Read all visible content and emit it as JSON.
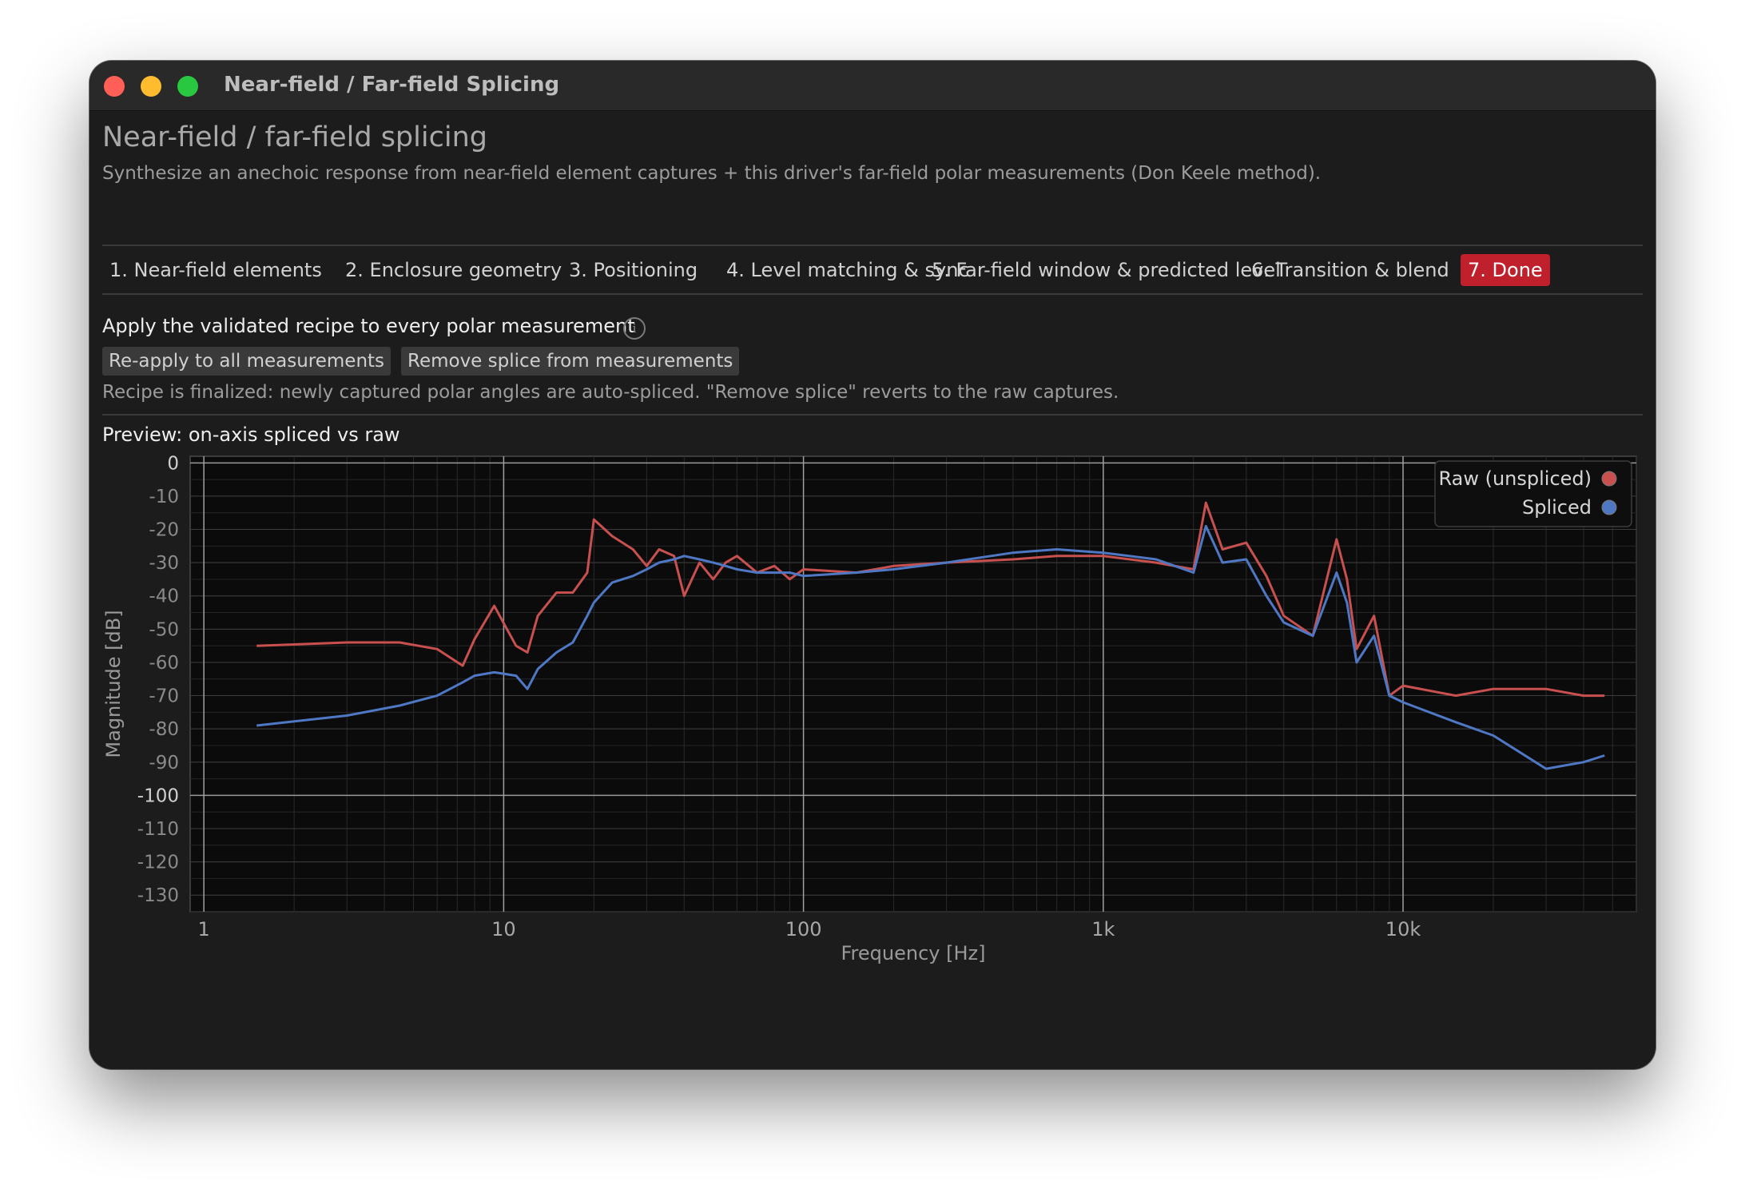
{
  "window": {
    "title": "Near-field / Far-field Splicing"
  },
  "header": {
    "title": "Near-field / far-field splicing",
    "subtitle": "Synthesize an anechoic response from near-field element captures + this driver's far-field polar measurements (Don Keele method)."
  },
  "tabs": [
    {
      "label": "1. Near-field elements"
    },
    {
      "label": "2. Enclosure geometry"
    },
    {
      "label": "3. Positioning"
    },
    {
      "label": "4. Level matching & sync"
    },
    {
      "label": "5. Far-field window & predicted level"
    },
    {
      "label": "6. Transition & blend"
    },
    {
      "label": "7. Done",
      "active": true
    }
  ],
  "apply": {
    "label": "Apply the validated recipe to every polar measurement",
    "info_icon": "i",
    "reapply_button": "Re-apply to all measurements",
    "remove_button": "Remove splice from measurements",
    "note": "Recipe is finalized: newly captured polar angles are auto-spliced. \"Remove splice\" reverts to the raw captures."
  },
  "preview": {
    "title": "Preview: on-axis spliced vs raw"
  },
  "colors": {
    "raw": "#c8504f",
    "spliced": "#4f78c4",
    "accent": "#c0202c"
  },
  "chart_data": {
    "type": "line",
    "xscale": "log",
    "xlabel": "Frequency [Hz]",
    "ylabel": "Magnitude [dB]",
    "xlim": [
      0.9,
      60000
    ],
    "ylim": [
      -135,
      2
    ],
    "xticks": [
      {
        "v": 1,
        "label": "1"
      },
      {
        "v": 10,
        "label": "10"
      },
      {
        "v": 100,
        "label": "100"
      },
      {
        "v": 1000,
        "label": "1k"
      },
      {
        "v": 10000,
        "label": "10k"
      }
    ],
    "yticks": [
      0,
      -10,
      -20,
      -30,
      -40,
      -50,
      -60,
      -70,
      -80,
      -90,
      -100,
      -110,
      -120,
      -130
    ],
    "grid": true,
    "legend": "top-right",
    "series": [
      {
        "name": "Raw (unspliced)",
        "color": "#c8504f",
        "x": [
          1.5,
          3,
          4.5,
          6,
          7.3,
          8,
          9.3,
          11,
          12,
          13,
          15,
          17,
          19,
          20,
          23,
          27,
          30,
          33,
          37,
          40,
          45,
          50,
          55,
          60,
          70,
          80,
          90,
          100,
          150,
          200,
          300,
          500,
          700,
          1000,
          1500,
          2000,
          2200,
          2500,
          3000,
          3500,
          4000,
          5000,
          6000,
          6500,
          7000,
          8000,
          9000,
          10000,
          15000,
          20000,
          30000,
          40000,
          47000
        ],
        "y": [
          -55,
          -54,
          -54,
          -56,
          -61,
          -53,
          -43,
          -55,
          -57,
          -46,
          -39,
          -39,
          -33,
          -17,
          -22,
          -26,
          -31,
          -26,
          -28,
          -40,
          -30,
          -35,
          -30,
          -28,
          -33,
          -31,
          -35,
          -32,
          -33,
          -31,
          -30,
          -29,
          -28,
          -28,
          -30,
          -32,
          -12,
          -26,
          -24,
          -34,
          -46,
          -52,
          -23,
          -35,
          -56,
          -46,
          -70,
          -67,
          -70,
          -68,
          -68,
          -70,
          -70
        ]
      },
      {
        "name": "Spliced",
        "color": "#4f78c4",
        "x": [
          1.5,
          3,
          4.5,
          6,
          7.3,
          8,
          9.3,
          11,
          12,
          13,
          15,
          17,
          19,
          20,
          23,
          27,
          30,
          33,
          37,
          40,
          45,
          50,
          55,
          60,
          70,
          80,
          90,
          100,
          150,
          200,
          300,
          500,
          700,
          1000,
          1500,
          2000,
          2200,
          2500,
          3000,
          3500,
          4000,
          5000,
          6000,
          6500,
          7000,
          8000,
          9000,
          10000,
          15000,
          20000,
          30000,
          40000,
          47000
        ],
        "y": [
          -79,
          -76,
          -73,
          -70,
          -66,
          -64,
          -63,
          -64,
          -68,
          -62,
          -57,
          -54,
          -46,
          -42,
          -36,
          -34,
          -32,
          -30,
          -29,
          -28,
          -29,
          -30,
          -31,
          -32,
          -33,
          -33,
          -33,
          -34,
          -33,
          -32,
          -30,
          -27,
          -26,
          -27,
          -29,
          -33,
          -19,
          -30,
          -29,
          -40,
          -48,
          -52,
          -33,
          -42,
          -60,
          -52,
          -70,
          -72,
          -78,
          -82,
          -92,
          -90,
          -88
        ]
      }
    ]
  }
}
